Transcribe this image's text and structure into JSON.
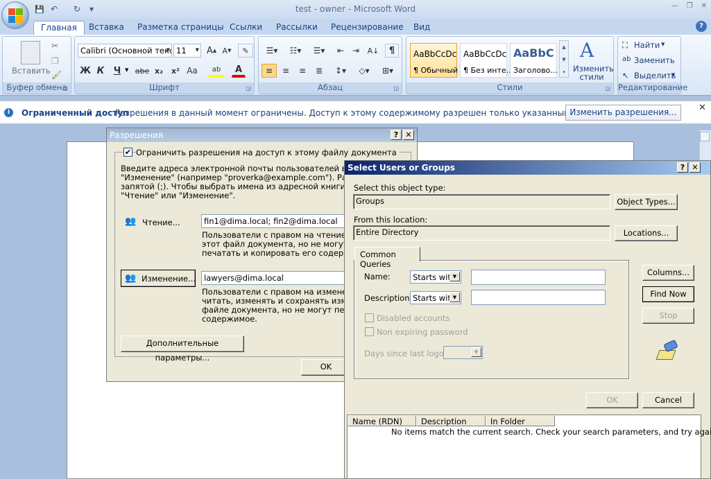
{
  "window": {
    "title": "test - owner - Microsoft Word",
    "min_label": "—",
    "max_label": "❐",
    "close_label": "✕"
  },
  "qat": {
    "save_glyph": "💾",
    "undo_glyph": "↶",
    "redo_glyph": "↻",
    "more_glyph": "▾"
  },
  "ribbon_tabs": [
    "Главная",
    "Вставка",
    "Разметка страницы",
    "Ссылки",
    "Рассылки",
    "Рецензирование",
    "Вид"
  ],
  "ribbon": {
    "clipboard": {
      "label": "Буфер обмена",
      "paste": "Вставить"
    },
    "font": {
      "label": "Шрифт",
      "font_name": "Calibri (Основной текс",
      "font_size": "11",
      "bold": "Ж",
      "italic": "К",
      "underline": "Ч",
      "strike": "abe",
      "sub": "x₂",
      "sup": "x²",
      "case": "Aa"
    },
    "paragraph": {
      "label": "Абзац"
    },
    "styles": {
      "label": "Стили",
      "items": [
        {
          "preview": "AaBbCcDc",
          "name": "¶ Обычный"
        },
        {
          "preview": "AaBbCcDc",
          "name": "¶ Без инте..."
        },
        {
          "preview": "AaBbC",
          "name": "Заголово..."
        }
      ],
      "change": "Изменить стили"
    },
    "editing": {
      "label": "Редактирование",
      "find": "Найти",
      "replace": "Заменить",
      "select": "Выделить"
    }
  },
  "message_bar": {
    "title": "Ограниченный доступ",
    "text": "Разрешения в данный момент ограничены. Доступ к этому содержимому разрешен только указанным пользователям.",
    "button": "Изменить разрешения..."
  },
  "permissions_dialog": {
    "title": "Разрешения",
    "restrict_label": "Ограничить разрешения на доступ к этому файлу документа",
    "instructions": [
      "Введите адреса электронной почты пользователей в поля \"Чт",
      "\"Изменение\" (например \"proverka@example.com\"). Разделяйте и",
      "запятой (;). Чтобы выбрать имена из адресной книги, нажмите",
      "\"Чтение\" или \"Изменение\"."
    ],
    "read_button": "Чтение...",
    "read_value": "fin1@dima.local; fin2@dima.local",
    "read_desc": [
      "Пользователи с правом на чтение могут",
      "этот файл документа, но не могут измен",
      "печатать и копировать его содержимое."
    ],
    "change_button": "Изменение...",
    "change_value": "lawyers@dima.local",
    "change_desc": [
      "Пользователи с правом на изменение мо",
      "читать, изменять и сохранять изменени",
      "файле документа, но не могут печатать",
      "содержимое."
    ],
    "more_button": "Дополнительные параметры...",
    "ok_button": "OK"
  },
  "select_dialog": {
    "title": "Select Users or Groups",
    "object_type_label": "Select this object type:",
    "object_type_value": "Groups",
    "object_types_button": "Object Types...",
    "location_label": "From this location:",
    "location_value": "Entire Directory",
    "locations_button": "Locations...",
    "tab": "Common Queries",
    "name_label": "Name:",
    "name_mode": "Starts with",
    "desc_label": "Description:",
    "desc_mode": "Starts with",
    "disabled_accounts": "Disabled accounts",
    "non_expiring": "Non expiring password",
    "days_label": "Days since last logon:",
    "columns_button": "Columns...",
    "find_now_button": "Find Now",
    "stop_button": "Stop",
    "ok_button": "OK",
    "cancel_button": "Cancel",
    "columns": [
      "Name (RDN)",
      "Description",
      "In Folder"
    ],
    "empty_message": "No items match the current search. Check your search parameters, and try again."
  }
}
